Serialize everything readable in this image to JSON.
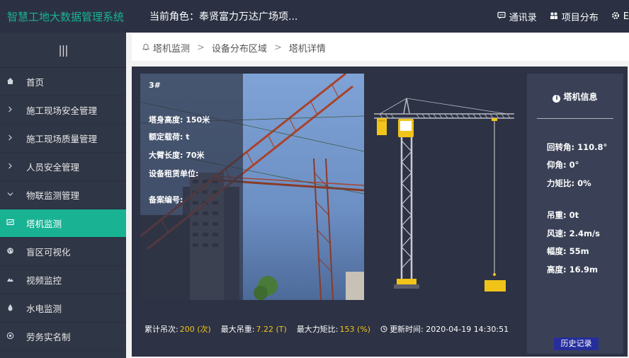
{
  "app": {
    "title": "智慧工地大数据管理系统",
    "role": "当前角色：奉贤富力万达广场项..."
  },
  "topnav": [
    {
      "icon": "chat-icon",
      "label": "通讯录"
    },
    {
      "icon": "project-icon",
      "label": "项目分布"
    },
    {
      "icon": "settings-icon",
      "label": "E"
    }
  ],
  "sidebar": {
    "toggle": "|||",
    "items": [
      {
        "icon": "home-icon",
        "label": "首页"
      },
      {
        "icon": "chevron-right-icon",
        "label": "施工现场安全管理"
      },
      {
        "icon": "chevron-right-icon",
        "label": "施工现场质量管理"
      },
      {
        "icon": "chevron-right-icon",
        "label": "人员安全管理"
      },
      {
        "icon": "chevron-down-icon",
        "label": "物联监测管理"
      },
      {
        "icon": "monitor-icon",
        "label": "塔机监测"
      },
      {
        "icon": "globe-icon",
        "label": "盲区可视化"
      },
      {
        "icon": "video-icon",
        "label": "视频监控"
      },
      {
        "icon": "drop-icon",
        "label": "水电监测"
      },
      {
        "icon": "id-icon",
        "label": "劳务实名制"
      }
    ]
  },
  "breadcrumb": [
    "塔机监测",
    "设备分布区域",
    "塔机详情"
  ],
  "crane": {
    "number": "3#",
    "height": "塔身高度: 150米",
    "rated_load": "额定载荷: t",
    "arm_length": "大臂长度: 70米",
    "lessor": "设备租赁单位:",
    "record_no": "备案编号:"
  },
  "stats": {
    "lifts_label": "累计吊次:",
    "lifts_value": "200 (次)",
    "max_load_label": "最大吊重:",
    "max_load_value": "7.22 (T)",
    "max_moment_label": "最大力矩比:",
    "max_moment_value": "153 (%)",
    "update_label": "更新时间: 2020-04-19 14:30:51"
  },
  "info": {
    "title": "塔机信息",
    "rotation": "回转角: 110.8°",
    "pitch": "仰角: 0°",
    "moment": "力矩比: 0%",
    "load": "吊重: 0t",
    "wind": "风速: 2.4m/s",
    "amplitude": "幅度: 55m",
    "hook_height": "高度: 16.9m",
    "history_button": "历史记录"
  },
  "colors": {
    "accent": "#19b394",
    "highlight": "#f0c419",
    "panel": "#2d3244",
    "sidebar": "#2f3645"
  }
}
